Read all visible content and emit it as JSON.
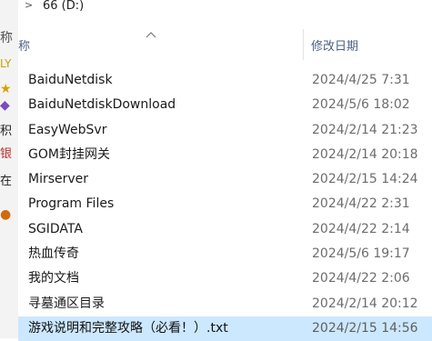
{
  "breadcrumb": {
    "drive_label": "66 (D:)"
  },
  "header": {
    "col_name": "称",
    "col_date": "修改日期"
  },
  "background_glyphs": [
    "称",
    "LY",
    "★",
    "◆",
    "积",
    "银",
    "在",
    "●"
  ],
  "files": [
    {
      "name": "BaiduNetdisk",
      "date": "2024/4/25 7:31"
    },
    {
      "name": "BaiduNetdiskDownload",
      "date": "2024/5/6 18:02"
    },
    {
      "name": "EasyWebSvr",
      "date": "2024/2/14 21:23"
    },
    {
      "name": "GOM封挂网关",
      "date": "2024/2/14 20:18"
    },
    {
      "name": "Mirserver",
      "date": "2024/2/15 14:24"
    },
    {
      "name": "Program Files",
      "date": "2024/4/22 2:31"
    },
    {
      "name": "SGIDATA",
      "date": "2024/4/22 2:14"
    },
    {
      "name": "热血传奇",
      "date": "2024/5/6 19:17"
    },
    {
      "name": "我的文档",
      "date": "2024/4/22 2:06"
    },
    {
      "name": "寻墓通区目录",
      "date": "2024/2/14 20:12"
    },
    {
      "name": "游戏说明和完整攻略（必看！）.txt",
      "date": "2024/2/15 14:56"
    }
  ],
  "selected_file": "游戏说明和完整攻略（必看！）.txt",
  "colors": {
    "selection": "#cce8ff",
    "header_text": "#4d6082",
    "date_text": "#6d6d6d"
  }
}
